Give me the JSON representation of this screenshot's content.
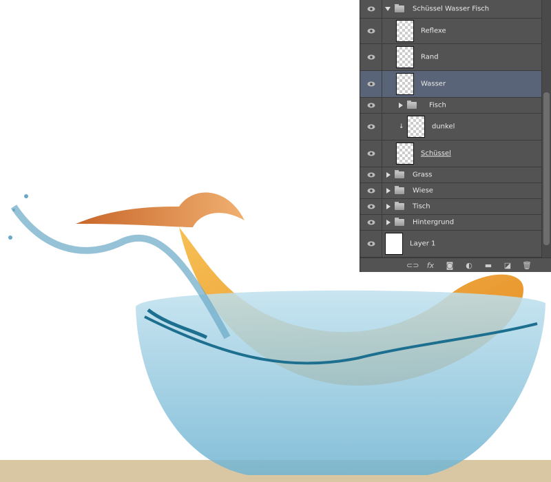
{
  "layers_panel": {
    "layers": [
      {
        "name": "Schüssel Wasser Fisch",
        "type": "group",
        "expanded": true,
        "visible": true
      },
      {
        "name": "Reflexe",
        "type": "layer",
        "visible": true
      },
      {
        "name": "Rand",
        "type": "layer",
        "visible": true
      },
      {
        "name": "Wasser",
        "type": "layer",
        "visible": true,
        "selected": true
      },
      {
        "name": "Fisch",
        "type": "group",
        "expanded": false,
        "visible": true
      },
      {
        "name": "dunkel",
        "type": "layer",
        "clipped": true,
        "visible": true
      },
      {
        "name": "Schüssel",
        "type": "layer",
        "visible": true
      },
      {
        "name": "Grass",
        "type": "group",
        "expanded": false,
        "visible": true
      },
      {
        "name": "Wiese",
        "type": "group",
        "expanded": false,
        "visible": true
      },
      {
        "name": "Tisch",
        "type": "group",
        "expanded": false,
        "visible": true
      },
      {
        "name": "Hintergrund",
        "type": "group",
        "expanded": false,
        "visible": true
      },
      {
        "name": "Layer 1",
        "type": "layer",
        "visible": true
      }
    ],
    "footer": {
      "fx_label": "fx",
      "icons": [
        "link-layers-icon",
        "fx-icon",
        "layer-mask-icon",
        "adjustment-layer-icon",
        "new-group-icon",
        "new-layer-icon",
        "trash-icon"
      ]
    },
    "colors": {
      "panel": "#535353",
      "selected": "#5a6478"
    }
  }
}
